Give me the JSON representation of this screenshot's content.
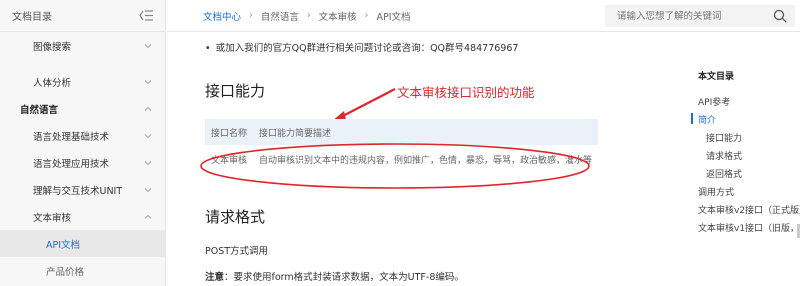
{
  "sidebar": {
    "title": "文档目录",
    "items": [
      {
        "label": "图像搜索",
        "level": "section",
        "expanded": false
      },
      {
        "label": "人体分析",
        "level": "section",
        "expanded": false
      },
      {
        "label": "自然语言",
        "level": "top",
        "expanded": true
      },
      {
        "label": "语言处理基础技术",
        "level": "section",
        "expanded": false
      },
      {
        "label": "语言处理应用技术",
        "level": "section",
        "expanded": false
      },
      {
        "label": "理解与交互技术UNIT",
        "level": "section",
        "expanded": false
      },
      {
        "label": "文本审核",
        "level": "section",
        "expanded": true
      },
      {
        "label": "API文档",
        "level": "sub",
        "active": true
      },
      {
        "label": "产品价格",
        "level": "sub"
      }
    ]
  },
  "breadcrumb": {
    "home": "文档中心",
    "items": [
      "自然语言",
      "文本审核",
      "API文档"
    ]
  },
  "search": {
    "placeholder": "请输入您想了解的关键词"
  },
  "content": {
    "bullet": "或加入我们的官方QQ群进行相关问题讨论或咨询：QQ群号484776967",
    "section1_title": "接口能力",
    "annotation": "文本审核接口识别的功能",
    "table": {
      "headers": [
        "接口名称",
        "接口能力简要描述"
      ],
      "rows": [
        [
          "文本审核",
          "自动审核识别文本中的违规内容，例如推广，色情，暴恐，辱骂，政治敏感，灌水等"
        ]
      ]
    },
    "section2_title": "请求格式",
    "post_line": "POST方式调用",
    "note_label": "注意",
    "note_text": "：要求使用form格式封装请求数据，文本为UTF-8编码。"
  },
  "toc": {
    "title": "本文目录",
    "items": [
      {
        "label": "API参考",
        "indent": 0
      },
      {
        "label": "简介",
        "indent": 0,
        "active": true
      },
      {
        "label": "接口能力",
        "indent": 1
      },
      {
        "label": "请求格式",
        "indent": 1
      },
      {
        "label": "返回格式",
        "indent": 1
      },
      {
        "label": "调用方式",
        "indent": 0
      },
      {
        "label": "文本审核v2接口（正式版）",
        "indent": 0
      },
      {
        "label": "文本审核v1接口（旧版，",
        "indent": 0
      }
    ]
  },
  "colors": {
    "accent": "#1a6fd6",
    "annotation_red": "#e0262a",
    "table_header_bg": "#eaf1f9"
  }
}
